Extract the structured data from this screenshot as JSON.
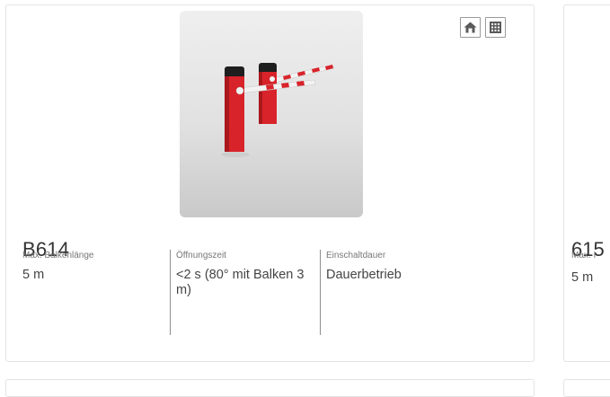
{
  "cards": [
    {
      "title": "B614",
      "specs": [
        {
          "label": "Max. Balkenlänge",
          "value": "5 m"
        },
        {
          "label": "Öffnungszeit",
          "value": "<2 s (80° mit Balken 3 m)"
        },
        {
          "label": "Einschaltdauer",
          "value": "Dauerbetrieb"
        }
      ],
      "badges": [
        "house-icon",
        "building-icon"
      ]
    },
    {
      "title_partial": "615",
      "label_partial": "Max. I",
      "value_partial": "5 m"
    }
  ],
  "colors": {
    "barrier_red": "#d8232a",
    "barrier_cap": "#1e1e1e",
    "border": "#e3e3e3"
  }
}
